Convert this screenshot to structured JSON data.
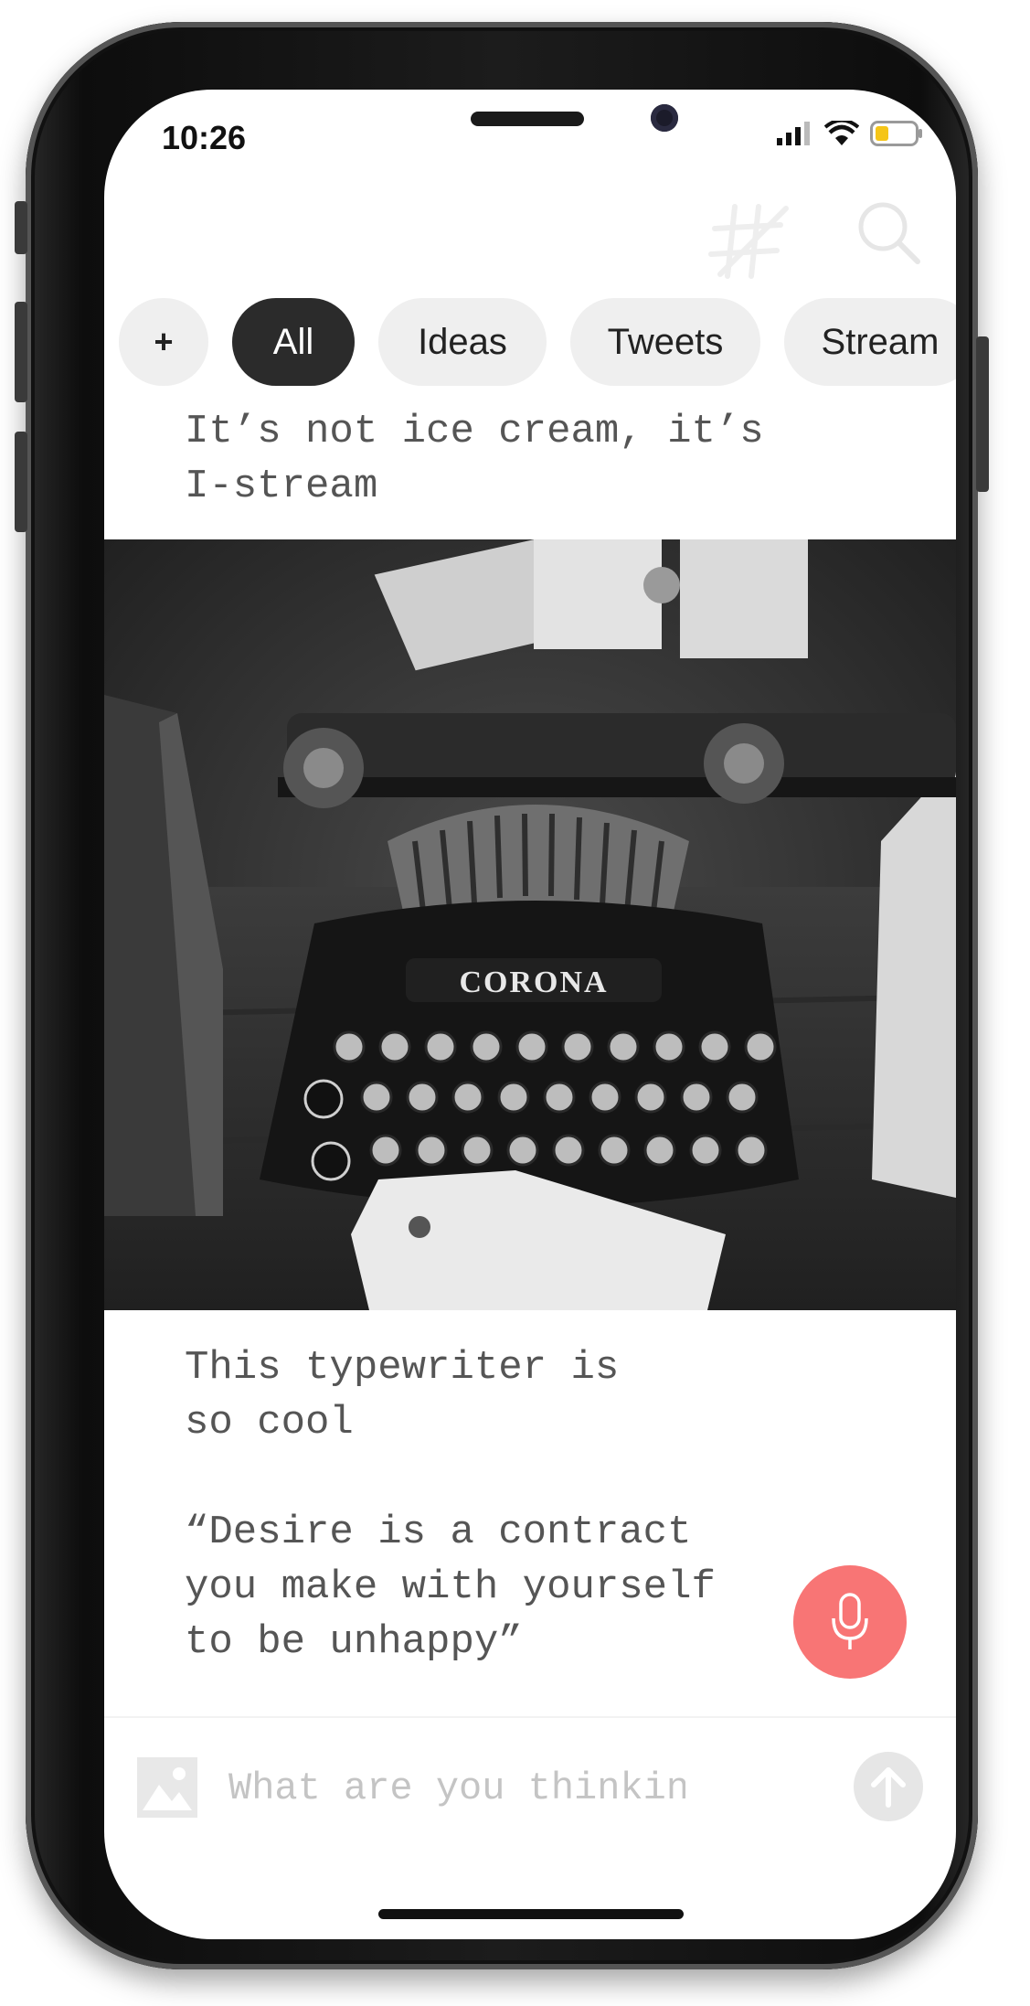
{
  "status_bar": {
    "time": "10:26"
  },
  "header": {
    "logo_icon": "hashtag-logo-icon",
    "search_icon": "search-icon"
  },
  "filters": {
    "add_label": "+",
    "chips": [
      "All",
      "Ideas",
      "Tweets",
      "Stream"
    ],
    "active": "All"
  },
  "notes": [
    {
      "text": "It’s not ice cream, it’s\nI-stream"
    },
    {
      "image": "typewriter-photo",
      "text": "This typewriter is\nso cool\n\n“Desire is a contract\nyou make with yourself\nto be unhappy”"
    }
  ],
  "mic": {
    "icon": "microphone-icon",
    "color": "#f87575"
  },
  "composer": {
    "placeholder": "What are you thinking?",
    "image_icon": "image-icon",
    "send_icon": "arrow-up-icon"
  },
  "photo_caption": "CORONA"
}
